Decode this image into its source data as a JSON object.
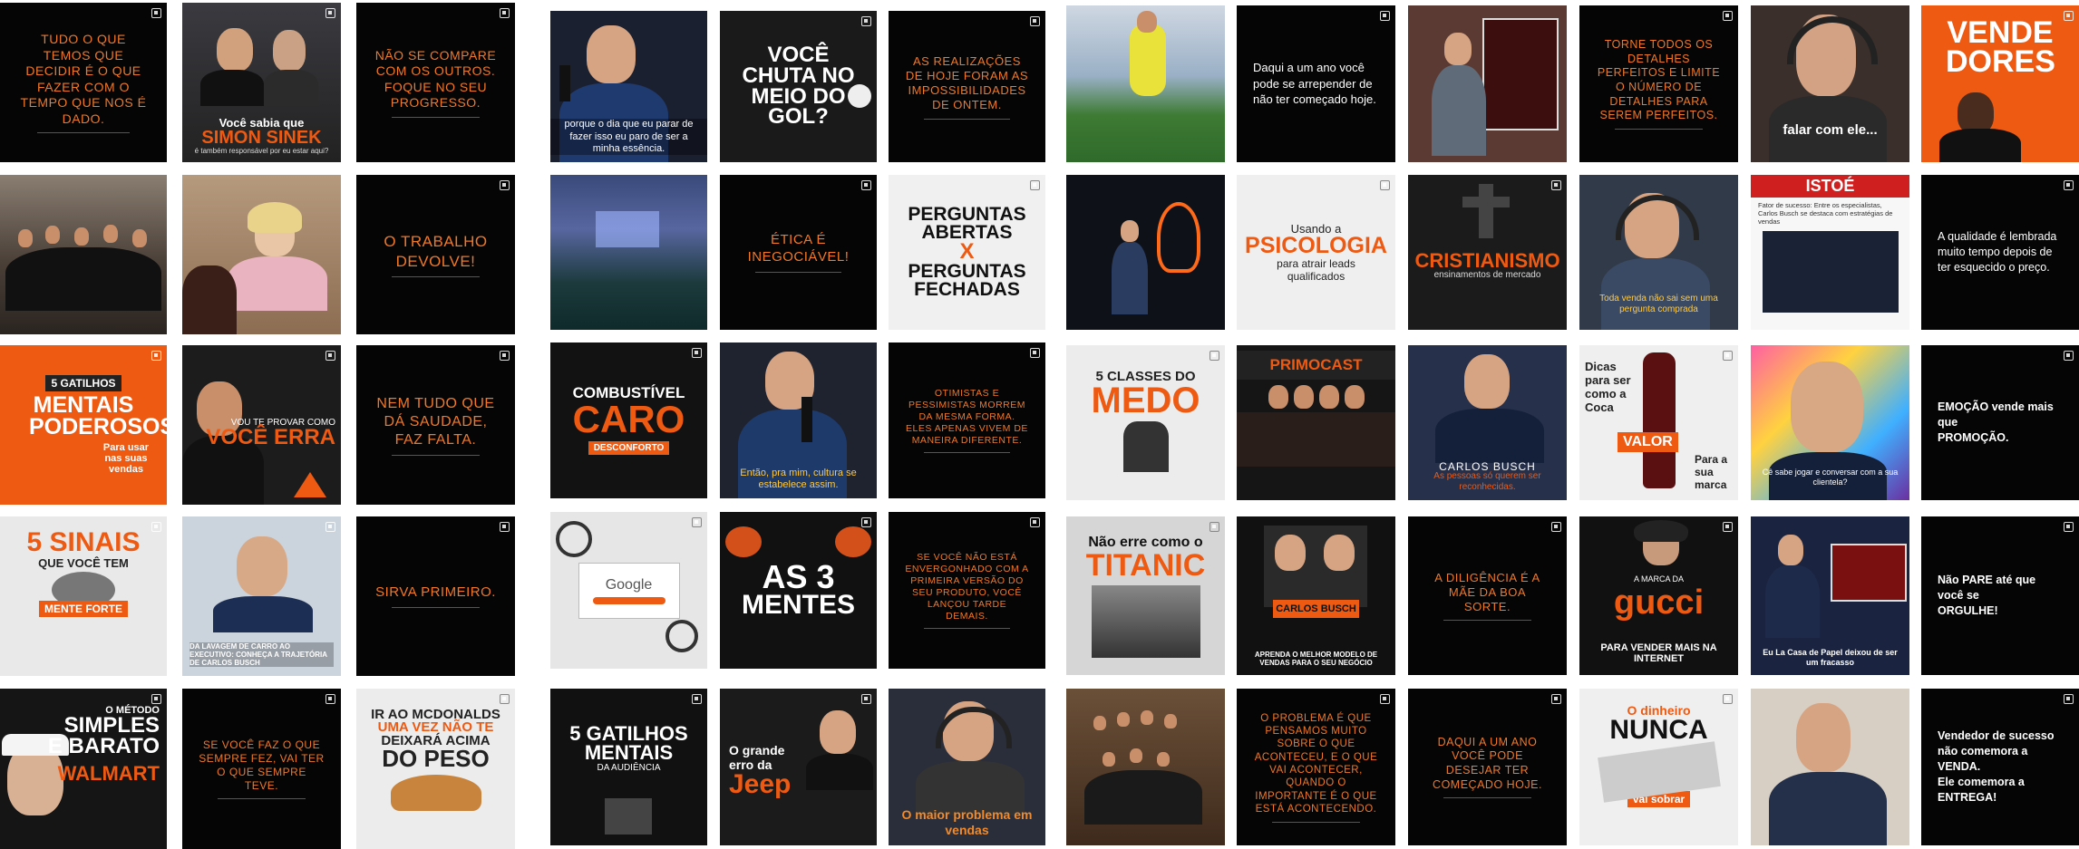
{
  "colors": {
    "accent": "#ee5a12",
    "text_orange": "#f07828",
    "tile_black": "#050505",
    "page_bg": "#ffffff"
  },
  "grid": {
    "g1": {
      "r1c1": "TUDO O QUE TEMOS QUE DECIDIR É O QUE FAZER COM O TEMPO QUE NOS É DADO.",
      "r1c2_line1": "Você sabia que",
      "r1c2_name": "SIMON SINEK",
      "r1c2_line2": "é também responsável por eu estar aqui?",
      "r1c3": "NÃO SE COMPARE COM OS OUTROS. FOQUE NO SEU PROGRESSO.",
      "r2c3": "O TRABALHO DEVOLVE!",
      "r3c1_small": "5 GATILHOS",
      "r3c1_big": "MENTAIS PODEROSOS",
      "r3c1_sub": "Para usar nas suas vendas",
      "r3c2_line1": "VOU TE PROVAR COMO",
      "r3c2_big": "VOCÊ ERRA",
      "r3c3": "NEM TUDO QUE DÁ SAUDADE, FAZ FALTA.",
      "r4c1_big": "5 SINAIS",
      "r4c1_sub": "QUE VOCÊ TEM",
      "r4c1_badge": "MENTE FORTE",
      "r4c2_caption": "DA LAVAGEM DE CARRO AO EXECUTIVO: CONHEÇA A TRAJETÓRIA DE CARLOS BUSCH",
      "r4c3": "SIRVA PRIMEIRO.",
      "r5c1_small": "O MÉTODO",
      "r5c1_big1": "SIMPLES",
      "r5c1_big2": "E BARATO",
      "r5c1_big3": "WALMART",
      "r5c2": "SE VOCÊ FAZ O QUE SEMPRE FEZ, VAI TER O QUE SEMPRE TEVE.",
      "r5c3_line1": "IR AO MCDONALDS",
      "r5c3_line2": "UMA VEZ NÃO TE",
      "r5c3_line3": "DEIXARÁ ACIMA",
      "r5c3_big": "DO PESO"
    },
    "g2": {
      "r1c1_caption": "porque o dia que eu parar de fazer isso eu paro de ser a minha essência.",
      "r1c2_big": "VOCÊ CHUTA NO MEIO DO GOL?",
      "r1c3": "AS REALIZAÇÕES DE HOJE FORAM AS IMPOSSIBILIDADES DE ONTEM.",
      "r2c2": "ÉTICA É INEGOCIÁVEL!",
      "r2c3_big1": "PERGUNTAS ABERTAS",
      "r2c3_x": "X",
      "r2c3_big2": "PERGUNTAS FECHADAS",
      "r3c1_big1": "COMBUSTÍVEL",
      "r3c1_big2": "CARO",
      "r3c1_badge": "DESCONFORTO",
      "r3c2_caption": "Então, pra mim, cultura se estabelece assim.",
      "r3c3": "OTIMISTAS E PESSIMISTAS MORREM DA MESMA FORMA. ELES APENAS VIVEM DE MANEIRA DIFERENTE.",
      "r4c1_logo": "Google",
      "r4c2_big1": "AS 3",
      "r4c2_big2": "MENTES",
      "r4c3": "SE VOCÊ NÃO ESTÁ ENVERGONHADO COM A PRIMEIRA VERSÃO DO SEU PRODUTO, VOCÊ LANÇOU TARDE DEMAIS.",
      "r5c1_big1": "5 GATILHOS",
      "r5c1_big2": "MENTAIS",
      "r5c1_sub": "DA AUDIÊNCIA",
      "r5c2_line1": "O grande",
      "r5c2_line2": "erro da",
      "r5c2_big": "Jeep",
      "r5c3_caption": "O maior problema em vendas"
    },
    "g3": {
      "r1c2": "Daqui a um ano você pode se arrepender de não ter começado hoje.",
      "r1c4": "TORNE TODOS OS DETALHES PERFEITOS E LIMITE O NÚMERO DE DETALHES PARA SEREM PERFEITOS.",
      "r1c5_caption": "falar com ele...",
      "r1c6_big": "VENDE DORES",
      "r2c2_line1": "Usando a",
      "r2c2_big": "PSICOLOGIA",
      "r2c2_sub": "para atrair leads qualificados",
      "r2c3_big": "CRISTIANISMO",
      "r2c3_sub": "ensinamentos de mercado",
      "r2c4_caption": "Toda venda não sai sem uma pergunta comprada",
      "r2c5_logo": "ISTOÉ",
      "r2c5_text": "Fator de sucesso: Entre os especialistas, Carlos Busch se destaca com estratégias de vendas",
      "r2c6": "A qualidade é lembrada muito tempo depois de ter esquecido o preço.",
      "r3c1_small": "5 CLASSES DO",
      "r3c1_big": "MEDO",
      "r3c2_logo": "PRIMOCAST",
      "r3c3_name": "CARLOS BUSCH",
      "r3c3_caption": "As pessoas só querem ser reconhecidas.",
      "r3c4_line1": "Dicas para ser como a Coca",
      "r3c4_badge": "VALOR",
      "r3c4_sub": "Para a sua marca",
      "r3c5_caption": "Cê sabe jogar e conversar com a sua clientela?",
      "r3c6_line1": "EMOÇÃO vende mais que",
      "r3c6_line2": "PROMOÇÃO.",
      "r4c1_line1": "Não erre como o",
      "r4c1_big": "TITANIC",
      "r4c2_name": "CARLOS BUSCH",
      "r4c2_caption": "APRENDA O MELHOR MODELO DE VENDAS PARA O SEU NEGÓCIO",
      "r4c3": "A DILIGÊNCIA É A MÃE DA BOA SORTE.",
      "r4c4_line1": "A MARCA DA",
      "r4c4_big": "gucci",
      "r4c4_sub": "PARA VENDER MAIS NA INTERNET",
      "r4c5_caption": "Eu La Casa de Papel deixou de ser um fracasso",
      "r4c6_line1": "Não PARE até que você se",
      "r4c6_line2": "ORGULHE!",
      "r5c2": "O PROBLEMA É QUE PENSAMOS MUITO SOBRE O QUE ACONTECEU, E O QUE VAI ACONTECER, QUANDO O IMPORTANTE É O QUE ESTÁ ACONTECENDO.",
      "r5c3": "DAQUI A UM ANO VOCÊ PODE DESEJAR TER COMEÇADO HOJE.",
      "r5c4_line1": "O dinheiro",
      "r5c4_big": "NUNCA",
      "r5c4_sub": "vai sobrar",
      "r5c6_line1": "Vendedor de sucesso não comemora a VENDA.",
      "r5c6_line2": "Ele comemora a ENTREGA!"
    }
  }
}
